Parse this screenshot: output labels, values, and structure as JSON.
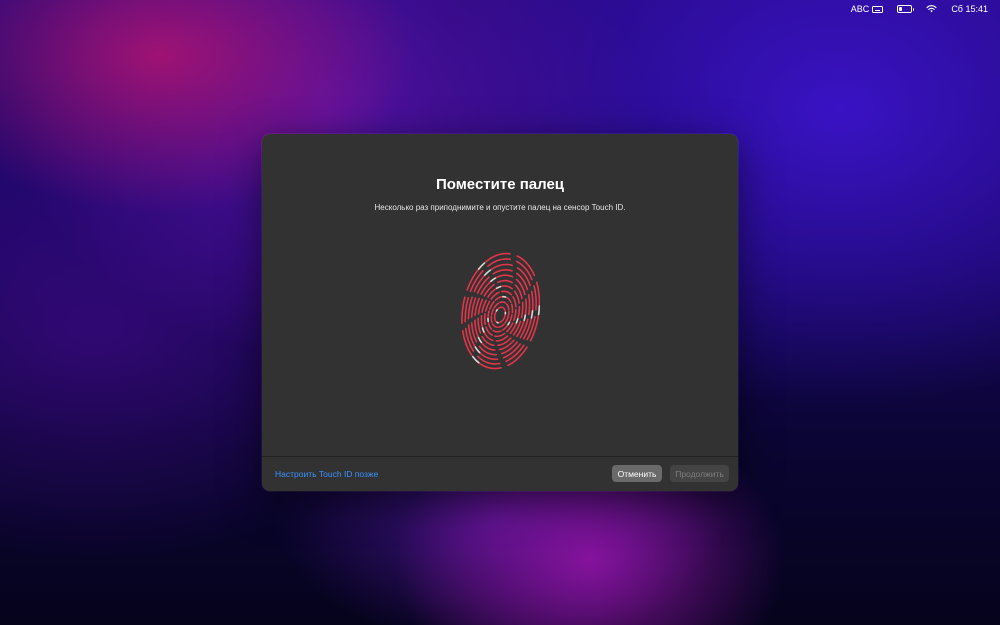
{
  "menubar": {
    "input_source": "ABC",
    "clock": "Сб 15:41",
    "icons": [
      "keyboard-icon",
      "battery-icon",
      "wifi-icon"
    ]
  },
  "dialog": {
    "title": "Поместите палец",
    "subtitle": "Несколько раз приподнимите и опустите палец на сенсор Touch ID.",
    "setup_later_link": "Настроить Touch ID позже",
    "cancel_label": "Отменить",
    "continue_label": "Продолжить"
  },
  "colors": {
    "accent_link": "#3b91ff",
    "fingerprint_captured": "#e0354a",
    "fingerprint_pending": "#d9d9d9",
    "dialog_bg": "#323232"
  }
}
